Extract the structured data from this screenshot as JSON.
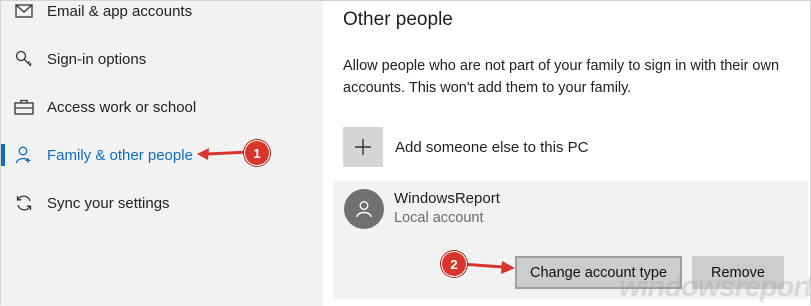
{
  "sidebar": {
    "items": [
      {
        "label": "Email & app accounts",
        "icon": "mail-icon"
      },
      {
        "label": "Sign-in options",
        "icon": "key-icon"
      },
      {
        "label": "Access work or school",
        "icon": "briefcase-icon"
      },
      {
        "label": "Family & other people",
        "icon": "person-icon",
        "active": true
      },
      {
        "label": "Sync your settings",
        "icon": "sync-icon"
      }
    ]
  },
  "main": {
    "title": "Other people",
    "description": "Allow people who are not part of your family to sign in with their own accounts. This won't add them to your family.",
    "add_label": "Add someone else to this PC",
    "account": {
      "name": "WindowsReport",
      "type": "Local account",
      "change_button": "Change account type",
      "remove_button": "Remove"
    }
  },
  "annotations": {
    "step1": "1",
    "step2": "2",
    "color": "#d9362b"
  },
  "watermark": "windowsreport",
  "colors": {
    "accent": "#0f6cbd",
    "sidebar_bg": "#f2f2f2",
    "button_bg": "#cccccc"
  }
}
